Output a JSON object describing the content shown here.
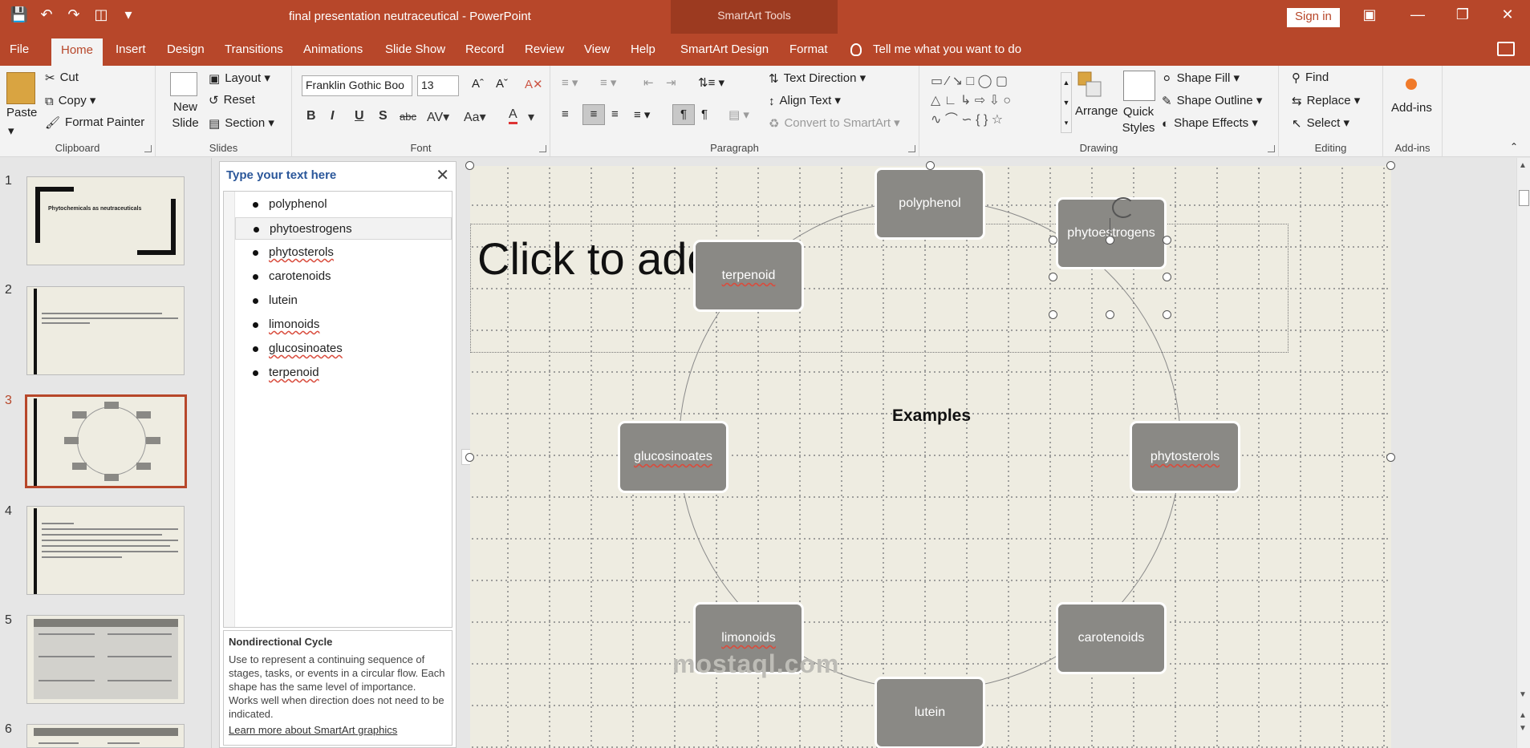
{
  "window": {
    "doc_title": "final presentation neutraceutical  -  PowerPoint",
    "contextual_tab_group": "SmartArt Tools",
    "sign_in": "Sign in"
  },
  "tabs": [
    "File",
    "Home",
    "Insert",
    "Design",
    "Transitions",
    "Animations",
    "Slide Show",
    "Record",
    "Review",
    "View",
    "Help",
    "SmartArt Design",
    "Format"
  ],
  "active_tab": "Home",
  "tell_me": "Tell me what you want to do",
  "ribbon": {
    "clipboard": {
      "label": "Clipboard",
      "paste": "Paste",
      "cut": "Cut",
      "copy": "Copy",
      "format_painter": "Format Painter"
    },
    "slides": {
      "label": "Slides",
      "new_slide": "New Slide",
      "layout": "Layout",
      "reset": "Reset",
      "section": "Section"
    },
    "font": {
      "label": "Font",
      "font_name": "Franklin Gothic Boo",
      "font_size": "13"
    },
    "paragraph": {
      "label": "Paragraph",
      "text_direction": "Text Direction",
      "align_text": "Align Text",
      "convert": "Convert to SmartArt"
    },
    "drawing": {
      "label": "Drawing",
      "arrange": "Arrange",
      "quick_styles": "Quick Styles",
      "shape_fill": "Shape Fill",
      "shape_outline": "Shape Outline",
      "shape_effects": "Shape Effects"
    },
    "editing": {
      "label": "Editing",
      "find": "Find",
      "replace": "Replace",
      "select": "Select"
    },
    "addins": {
      "label": "Add-ins",
      "addins": "Add-ins"
    }
  },
  "thumbnails": {
    "numbers": [
      "1",
      "2",
      "3",
      "4",
      "5",
      "6"
    ],
    "active_index": 3,
    "slide1_title": "Phytochemicals as neutraceuticals"
  },
  "text_pane": {
    "title": "Type your text here",
    "items": [
      "polyphenol",
      "phytoestrogens",
      "phytosterols",
      "carotenoids",
      "lutein",
      "limonoids",
      "glucosinoates",
      "terpenoid"
    ],
    "selected_item": "phytoestrogens",
    "layout_name": "Nondirectional Cycle",
    "layout_description": "Use to represent a continuing sequence of stages, tasks, or events in a circular flow. Each shape has the same level of importance. Works well when direction does not need to be indicated.",
    "learn_more": "Learn more about SmartArt graphics"
  },
  "slide": {
    "title_placeholder": "Click to add title",
    "center_label": "Examples",
    "nodes": [
      "polyphenol",
      "phytoestrogens",
      "phytosterols",
      "carotenoids",
      "lutein",
      "limonoids",
      "glucosinoates",
      "terpenoid"
    ],
    "selected_node": "phytoestrogens"
  },
  "watermark": "mostaql.com",
  "colors": {
    "accent": "#b7472a",
    "node_fill": "#8a8985",
    "slide_bg": "#eeece1"
  }
}
